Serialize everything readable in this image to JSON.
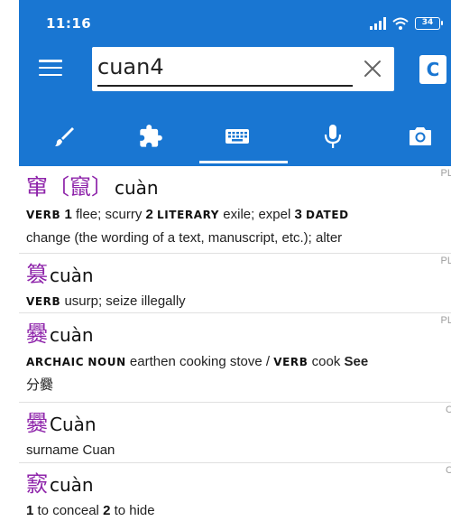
{
  "status_bar": {
    "time": "11:16",
    "battery": "34"
  },
  "search": {
    "query": "cuan4"
  },
  "c_button": {
    "label": "C"
  },
  "tabs": [
    {
      "icon": "brush-icon"
    },
    {
      "icon": "puzzle-icon"
    },
    {
      "icon": "keyboard-icon",
      "selected": true
    },
    {
      "icon": "microphone-icon"
    },
    {
      "icon": "camera-icon"
    }
  ],
  "colors": {
    "app_bar": "#1976d2",
    "hanzi": "#8e24aa"
  },
  "entries": [
    {
      "hanzi": "窜",
      "trad": "〔竄〕",
      "pinyin": "cuàn",
      "corner": "PL",
      "pos1": "VERB",
      "n1": "1",
      "d1": " flee; scurry ",
      "n2": "2",
      "pos2": "LITERARY",
      "d2": " exile; expel ",
      "n3": "3",
      "pos3": "DATED",
      "d3": "change (the wording of a text, manuscript, etc.); alter"
    },
    {
      "hanzi": "篡",
      "pinyin": "cuàn",
      "corner": "PL",
      "pos1": "VERB",
      "d1": " usurp; seize illegally"
    },
    {
      "hanzi": "爨",
      "pinyin": "cuàn",
      "corner": "PL",
      "pos1": "ARCHAIC",
      "pos2": "NOUN",
      "d1": " earthen cooking stove / ",
      "pos3": "VERB",
      "d2": " cook ",
      "see": "See",
      "d3": "分爨"
    },
    {
      "hanzi": "爨",
      "pinyin": "Cuàn",
      "corner": "C",
      "d1": "surname Cuan"
    },
    {
      "hanzi": "窾",
      "pinyin": "cuàn",
      "corner": "C",
      "n1": "1",
      "d1": " to conceal ",
      "n2": "2",
      "d2": " to hide"
    }
  ]
}
